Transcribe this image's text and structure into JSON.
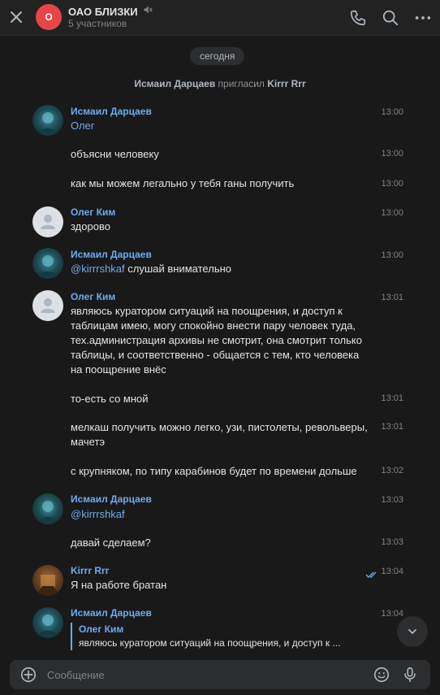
{
  "header": {
    "avatar_letter": "О",
    "title": "ОАО БЛИЗКИ",
    "subtitle": "5 участников",
    "icons": [
      "close-icon",
      "mute-icon",
      "phone-icon",
      "search-icon",
      "more-icon"
    ]
  },
  "colors": {
    "background": "#19191a",
    "header": "#222222",
    "accent": "#71aaeb",
    "avatar_red": "#e64646"
  },
  "feed": {
    "date": "сегодня",
    "service": {
      "actor": "Исмаил Дарцаев",
      "verb": "пригласил",
      "target": "Kirrr Rrr"
    },
    "messages": [
      {
        "author": "Исмаил Дарцаев",
        "time": "13:00",
        "text": "Олег",
        "text_is_mention": true
      },
      {
        "time": "13:00",
        "text": "объясни человеку"
      },
      {
        "time": "13:00",
        "text": "как мы можем легально у тебя ганы получить"
      },
      {
        "author": "Олег Ким",
        "time": "13:00",
        "text": "здорово"
      },
      {
        "author": "Исмаил Дарцаев",
        "time": "13:00",
        "mention": "@kirrrshkaf",
        "text": "слушай внимательно"
      },
      {
        "author": "Олег Ким",
        "time": "13:01",
        "text": "являюсь куратором ситуаций на поощрения, и доступ к таблицам имею, могу спокойно внести пару человек туда, тех.администрация архивы не смотрит, она смотрит только таблицы, и соответственно - общается с тем, кто человека на поощрение внёс"
      },
      {
        "time": "13:01",
        "text": "то-есть со мной"
      },
      {
        "time": "13:01",
        "text": "мелкаш получить можно легко, узи, пистолеты, револьверы, мачетэ"
      },
      {
        "time": "13:02",
        "text": "с крупняком, по типу карабинов будет по времени дольше"
      },
      {
        "author": "Исмаил Дарцаев",
        "time": "13:03",
        "text": "@kirrrshkaf",
        "text_is_mention": true
      },
      {
        "time": "13:03",
        "text": "давай сделаем?"
      },
      {
        "author": "Kirrr Rrr",
        "time": "13:04",
        "text": "Я на работе братан",
        "read": true
      },
      {
        "author": "Исмаил Дарцаев",
        "time": "13:04",
        "reply": {
          "author": "Олег Ким",
          "text": "являюсь куратором ситуаций на поощрения, и доступ к ..."
        }
      }
    ]
  },
  "composer": {
    "placeholder": "Сообщение"
  }
}
